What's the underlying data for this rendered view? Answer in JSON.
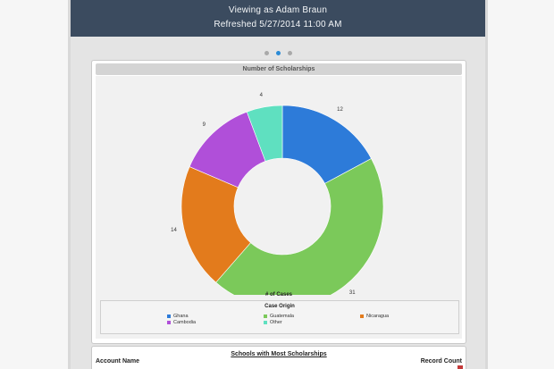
{
  "header": {
    "viewing_as": "Viewing as Adam Braun",
    "refreshed": "Refreshed 5/27/2014 11:00 AM"
  },
  "pager": {
    "pages": 3,
    "active_index": 1
  },
  "scholarships_card": {
    "title": "Number of Scholarships",
    "center_caption": "# of Cases",
    "legend_title": "Case Origin"
  },
  "chart_data": {
    "type": "pie",
    "title": "Number of Scholarships",
    "donut": true,
    "legend_title": "Case Origin",
    "series_label": "# of Cases",
    "categories": [
      "Ghana",
      "Guatemala",
      "Nicaragua",
      "Cambodia",
      "Other"
    ],
    "values": [
      12,
      31,
      14,
      9,
      4
    ],
    "colors": [
      "#2d7bd9",
      "#7bc95a",
      "#e37b1c",
      "#b04fd9",
      "#5fe0c0"
    ],
    "legend_placement": "bottom"
  },
  "schools_card": {
    "title": "Schools with Most Scholarships",
    "col_account": "Account Name",
    "col_count": "Record Count"
  }
}
